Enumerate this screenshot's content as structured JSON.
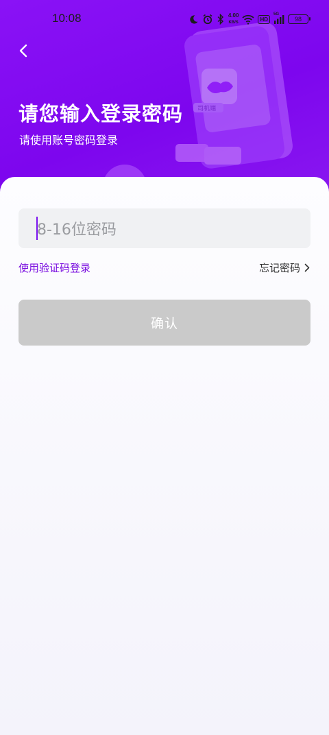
{
  "status_bar": {
    "time": "10:08",
    "net_speed_value": "4.00",
    "net_speed_unit": "KB/S",
    "hd_label": "HD",
    "signal_label": "5G",
    "battery": "98",
    "icons": [
      "moon-icon",
      "alarm-icon",
      "bluetooth-icon",
      "wifi-icon",
      "signal-icon",
      "battery-icon"
    ]
  },
  "header": {
    "back_icon": "chevron-left-icon",
    "title": "请您输入登录密码",
    "subtitle": "请使用账号密码登录",
    "illustration_badge": "司机端"
  },
  "form": {
    "password_placeholder": "8-16位密码",
    "sms_login_link": "使用验证码登录",
    "forgot_password_link": "忘记密码",
    "confirm_button": "确认"
  },
  "colors": {
    "brand_purple": "#8a12f6",
    "link_purple": "#7a0ddf",
    "button_disabled": "#cacaca"
  }
}
